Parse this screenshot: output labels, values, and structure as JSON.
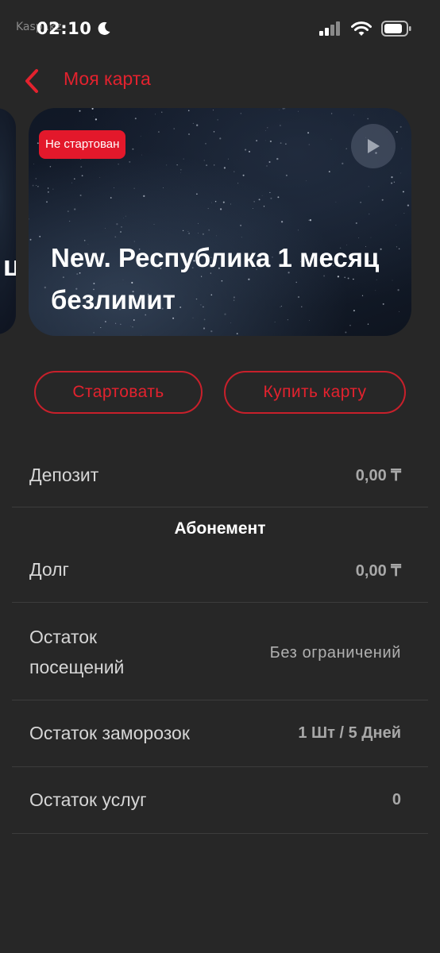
{
  "status_bar": {
    "time": "02:10",
    "overlay_text": "Kaspi.kz"
  },
  "header": {
    "title": "Моя карта"
  },
  "card": {
    "status_badge": "Не стартован",
    "title": "New. Республика 1 месяц безлимит",
    "prev_card_glyph": "ц"
  },
  "actions": {
    "start_label": "Стартовать",
    "buy_label": "Купить карту"
  },
  "details": {
    "deposit": {
      "label": "Депозит",
      "value": "0,00 ₸"
    },
    "section_title": "Абонемент",
    "debt": {
      "label": "Долг",
      "value": "0,00 ₸"
    },
    "visits_left": {
      "label": "Остаток посещений",
      "value": "Без ограничений"
    },
    "freezes_left": {
      "label": "Остаток заморозок",
      "value": "1 Шт / 5 Дней"
    },
    "services_left": {
      "label": "Остаток услуг",
      "value": "0"
    }
  },
  "colors": {
    "accent": "#e3222e",
    "background": "#272727",
    "badge": "#e3182b"
  },
  "icons": [
    "moon-icon",
    "signal-icon",
    "wifi-icon",
    "battery-icon",
    "back-chevron-icon",
    "play-icon"
  ]
}
